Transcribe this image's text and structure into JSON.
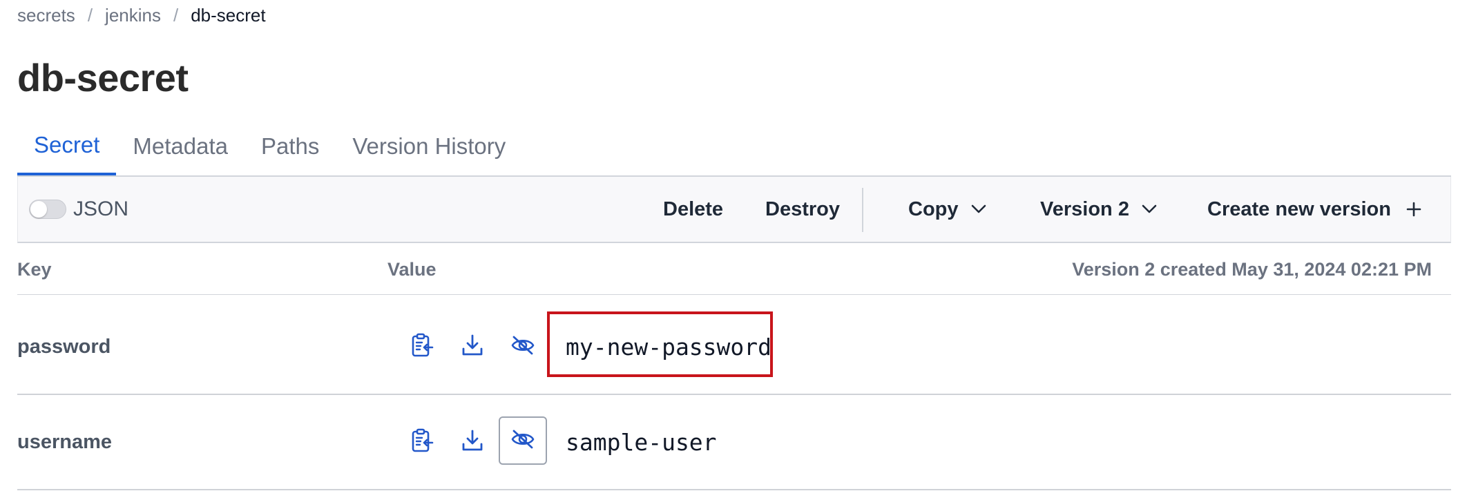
{
  "breadcrumb": {
    "items": [
      "secrets",
      "jenkins",
      "db-secret"
    ],
    "separator": "/"
  },
  "page": {
    "title": "db-secret"
  },
  "tabs": [
    {
      "label": "Secret",
      "active": true
    },
    {
      "label": "Metadata",
      "active": false
    },
    {
      "label": "Paths",
      "active": false
    },
    {
      "label": "Version History",
      "active": false
    }
  ],
  "toolbar": {
    "json_toggle": {
      "label": "JSON",
      "enabled": false
    },
    "delete_label": "Delete",
    "destroy_label": "Destroy",
    "copy_label": "Copy",
    "version_label": "Version 2",
    "create_label": "Create new version"
  },
  "table": {
    "headers": {
      "key": "Key",
      "value": "Value",
      "version_info": "Version 2 created May 31, 2024 02:21 PM"
    },
    "rows": [
      {
        "key": "password",
        "value": "my-new-password"
      },
      {
        "key": "username",
        "value": "sample-user"
      }
    ]
  },
  "colors": {
    "accent": "#1f62d6",
    "highlight": "#c8151b",
    "icon": "#2257c9"
  },
  "icons": {
    "copy": "clipboard-copy-icon",
    "download": "download-icon",
    "visibility": "eye-off-icon",
    "chevron": "chevron-down-icon",
    "plus": "plus-icon"
  }
}
